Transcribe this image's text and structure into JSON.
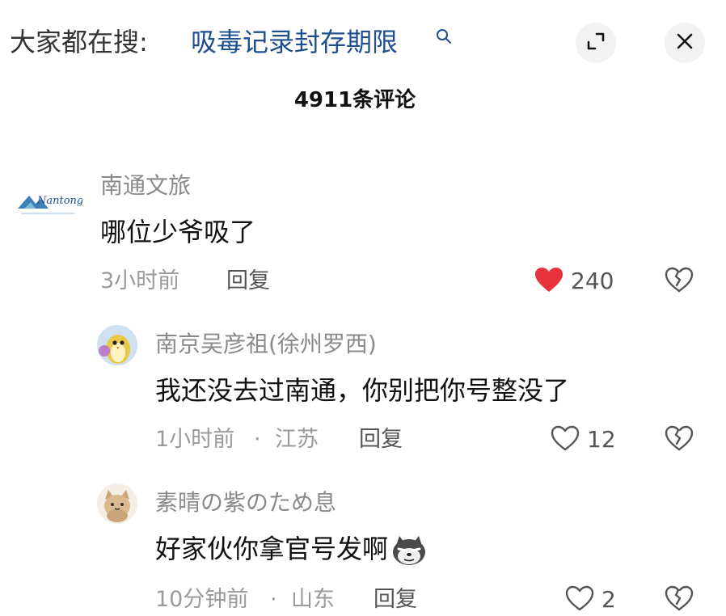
{
  "topbar": {
    "search_prefix": "大家都在搜:",
    "search_term": "吸毒记录封存期限",
    "search_icon": "search-icon",
    "expand_icon": "expand-icon",
    "close_icon": "close-icon"
  },
  "header": {
    "comment_count": "4911条评论"
  },
  "comments": [
    {
      "avatar": "nantong-logo",
      "avatar_text": "Nantong",
      "username": "南通文旅",
      "content": "哪位少爷吸了",
      "time": "3小时前",
      "reply_label": "回复",
      "likes": "240",
      "liked": true,
      "like_color": "#e8323c"
    },
    {
      "avatar": "penguin-avatar",
      "username": "南京吴彦祖(徐州罗西)",
      "content": "我还没去过南通，你别把你号整没了",
      "time": "1小时前",
      "separator": "·",
      "location": "江苏",
      "reply_label": "回复",
      "likes": "12",
      "liked": false
    },
    {
      "avatar": "cat-avatar",
      "username": "素晴の紫のため息",
      "content": "好家伙你拿官号发啊",
      "emoji": "husky-emoji",
      "time": "10分钟前",
      "separator": "·",
      "location": "山东",
      "reply_label": "回复",
      "likes": "2",
      "liked": false
    }
  ]
}
